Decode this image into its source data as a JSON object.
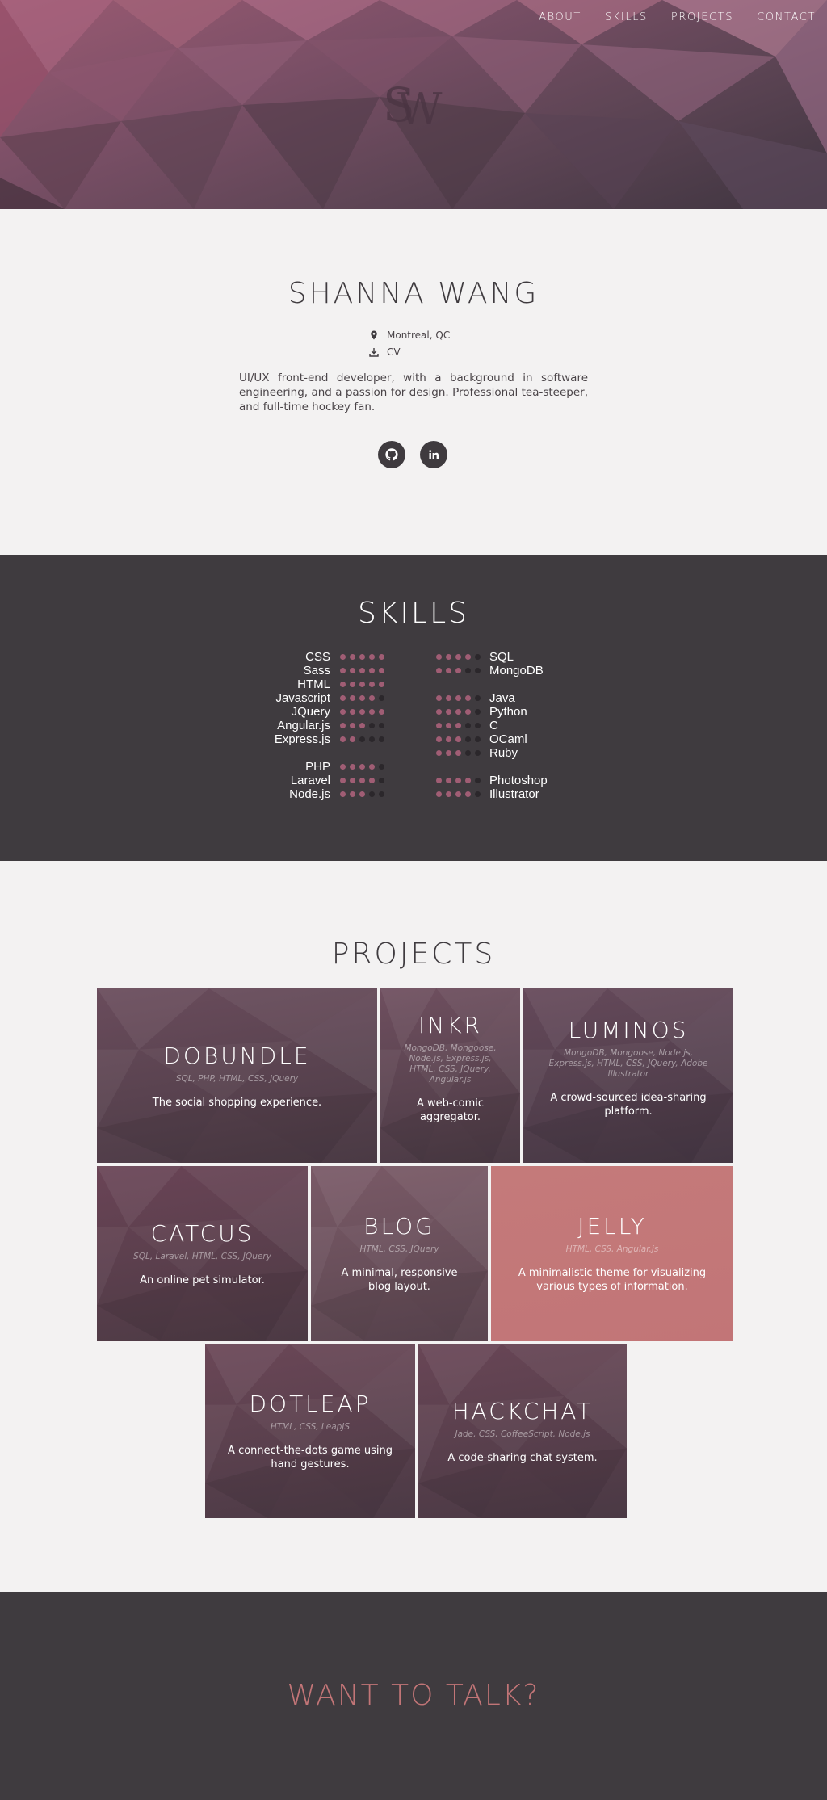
{
  "nav": {
    "about": "ABOUT",
    "skills": "SKILLS",
    "projects": "PROJECTS",
    "contact": "CONTACT"
  },
  "logo": {
    "text": "SW"
  },
  "intro": {
    "name": "SHANNA WANG",
    "location": "Montreal, QC",
    "cv": "CV",
    "bio": "UI/UX front-end developer, with a background in software engineering, and a passion for design. Professional tea-steeper, and full-time hockey fan.",
    "social": [
      {
        "icon": "github-icon"
      },
      {
        "icon": "linkedin-icon"
      }
    ]
  },
  "skills": {
    "title": "SKILLS",
    "left": [
      {
        "label": "CSS",
        "level": 5
      },
      {
        "label": "Sass",
        "level": 5
      },
      {
        "label": "HTML",
        "level": 5
      },
      {
        "label": "Javascript",
        "level": 4
      },
      {
        "label": "JQuery",
        "level": 5
      },
      {
        "label": "Angular.js",
        "level": 3
      },
      {
        "label": "Express.js",
        "level": 2
      },
      {
        "label": "PHP",
        "level": 4
      },
      {
        "label": "Laravel",
        "level": 4
      },
      {
        "label": "Node.js",
        "level": 3
      }
    ],
    "right": [
      {
        "label": "SQL",
        "level": 4
      },
      {
        "label": "MongoDB",
        "level": 3
      },
      {
        "label": "Java",
        "level": 4
      },
      {
        "label": "Python",
        "level": 4
      },
      {
        "label": "C",
        "level": 3
      },
      {
        "label": "OCaml",
        "level": 3
      },
      {
        "label": "Ruby",
        "level": 3
      },
      {
        "label": "Photoshop",
        "level": 4
      },
      {
        "label": "Illustrator",
        "level": 4
      }
    ]
  },
  "projects": {
    "title": "PROJECTS",
    "items": [
      {
        "name": "DOBUNDLE",
        "tech": "SQL, PHP, HTML, CSS, JQuery",
        "desc": "The social shopping experience."
      },
      {
        "name": "INKR",
        "tech": "MongoDB, Mongoose, Node.js, Express.js, HTML, CSS, JQuery, Angular.js",
        "desc": "A web-comic aggregator."
      },
      {
        "name": "LUMINOS",
        "tech": "MongoDB, Mongoose, Node.js, Express.js, HTML, CSS, JQuery, Adobe Illustrator",
        "desc": "A crowd-sourced idea-sharing platform."
      },
      {
        "name": "CATCUS",
        "tech": "SQL, Laravel, HTML, CSS, JQuery",
        "desc": "An online pet simulator."
      },
      {
        "name": "BLOG",
        "tech": "HTML, CSS, JQuery",
        "desc": "A minimal, responsive blog layout."
      },
      {
        "name": "JELLY",
        "tech": "HTML, CSS, Angular.js",
        "desc": "A minimalistic theme for visualizing various types of information."
      },
      {
        "name": "DOTLEAP",
        "tech": "HTML, CSS, LeapJS",
        "desc": "A connect-the-dots game using hand gestures."
      },
      {
        "name": "HACKCHAT",
        "tech": "Jade, CSS, CoffeeScript, Node.js",
        "desc": "A code-sharing chat system."
      }
    ]
  },
  "contact": {
    "title": "WANT TO TALK?"
  },
  "colors": {
    "accent": "#a05d74",
    "dark": "#3f3b3f",
    "light": "#f3f2f2",
    "contact": "#c27577",
    "jelly": "#c27577"
  }
}
